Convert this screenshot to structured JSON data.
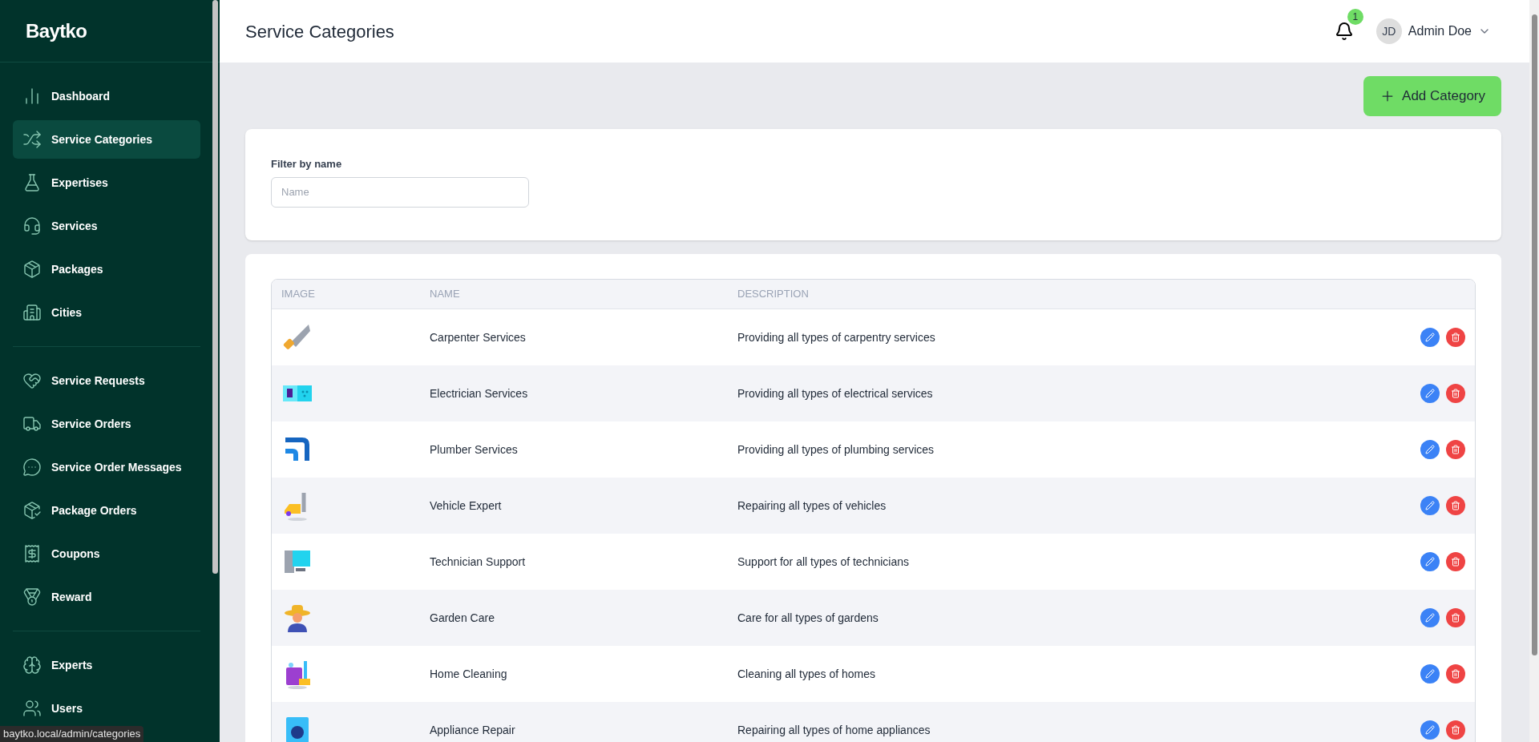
{
  "sidebar": {
    "logo": "Baytko",
    "sections": [
      [
        {
          "label": "Dashboard",
          "selected": false
        },
        {
          "label": "Service Categories",
          "selected": true
        },
        {
          "label": "Expertises",
          "selected": false
        },
        {
          "label": "Services",
          "selected": false
        },
        {
          "label": "Packages",
          "selected": false
        },
        {
          "label": "Cities",
          "selected": false
        }
      ],
      [
        {
          "label": "Service Requests",
          "selected": false
        },
        {
          "label": "Service Orders",
          "selected": false
        },
        {
          "label": "Service Order Messages",
          "selected": false
        },
        {
          "label": "Package Orders",
          "selected": false
        },
        {
          "label": "Coupons",
          "selected": false
        },
        {
          "label": "Reward",
          "selected": false
        }
      ],
      [
        {
          "label": "Experts",
          "selected": false
        },
        {
          "label": "Users",
          "selected": false
        }
      ]
    ]
  },
  "header": {
    "title": "Service Categories",
    "notification_count": "1",
    "user": {
      "initials": "JD",
      "name": "Admin Doe"
    }
  },
  "add_button": "Add Category",
  "filter": {
    "label": "Filter by name",
    "placeholder": "Name"
  },
  "table": {
    "columns": [
      "IMAGE",
      "NAME",
      "DESCRIPTION"
    ],
    "rows": [
      {
        "name": "Carpenter Services",
        "description": "Providing all types of carpentry services"
      },
      {
        "name": "Electrician Services",
        "description": "Providing all types of electrical services"
      },
      {
        "name": "Plumber Services",
        "description": "Providing all types of plumbing services"
      },
      {
        "name": "Vehicle Expert",
        "description": "Repairing all types of vehicles"
      },
      {
        "name": "Technician Support",
        "description": "Support for all types of technicians"
      },
      {
        "name": "Garden Care",
        "description": "Care for all types of gardens"
      },
      {
        "name": "Home Cleaning",
        "description": "Cleaning all types of homes"
      },
      {
        "name": "Appliance Repair",
        "description": "Repairing all types of home appliances"
      }
    ]
  },
  "status_url": "baytko.local/admin/categories"
}
